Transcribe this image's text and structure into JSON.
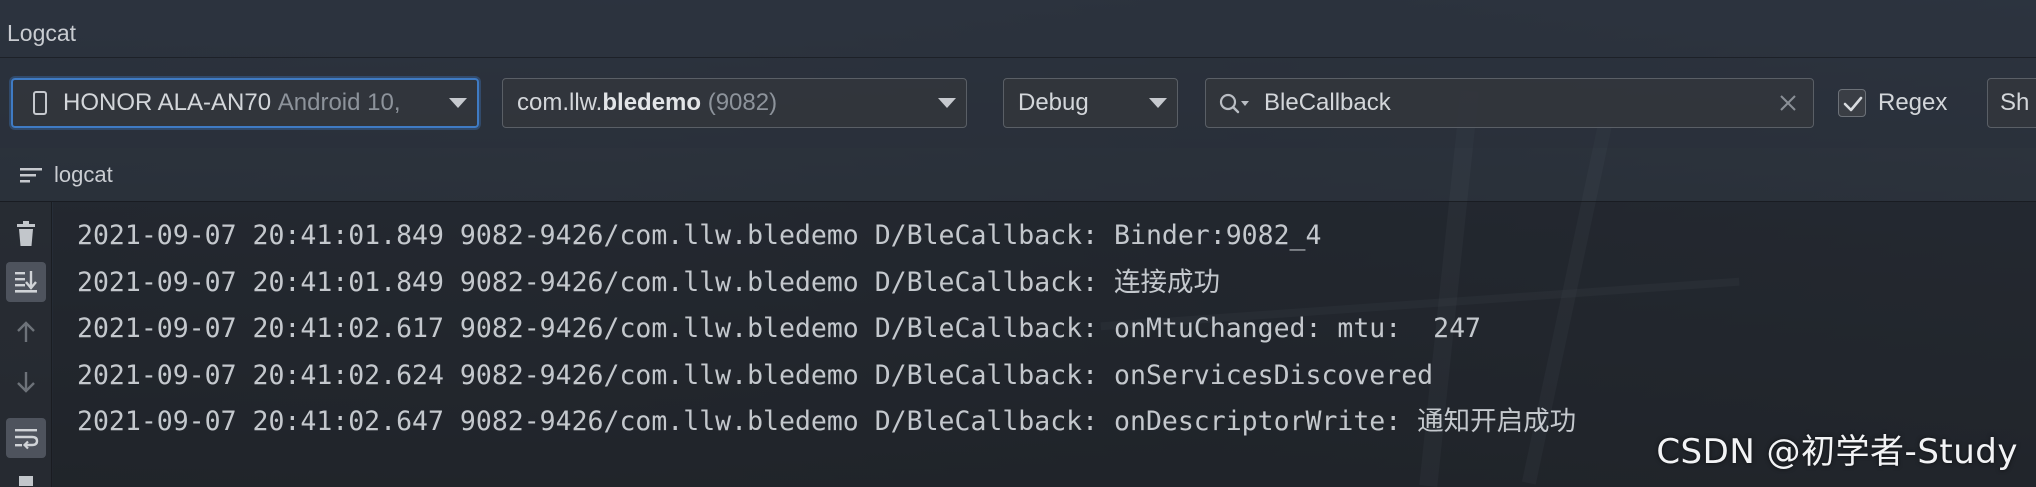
{
  "window": {
    "title": "Logcat"
  },
  "toolbar": {
    "device": {
      "name": "HONOR ALA-AN70",
      "detail": "Android 10,"
    },
    "package": {
      "prefix": "com.llw.",
      "bold": "bledemo",
      "pid": "(9082)"
    },
    "log_level": "Debug",
    "search": {
      "value": "BleCallback"
    },
    "regex": {
      "label": "Regex",
      "checked": true
    },
    "show_label": "Sh"
  },
  "tab": {
    "label": "logcat"
  },
  "log_lines": [
    "2021-09-07 20:41:01.849 9082-9426/com.llw.bledemo D/BleCallback: Binder:9082_4",
    "2021-09-07 20:41:01.849 9082-9426/com.llw.bledemo D/BleCallback: 连接成功",
    "2021-09-07 20:41:02.617 9082-9426/com.llw.bledemo D/BleCallback: onMtuChanged: mtu:  247",
    "2021-09-07 20:41:02.624 9082-9426/com.llw.bledemo D/BleCallback: onServicesDiscovered",
    "2021-09-07 20:41:02.647 9082-9426/com.llw.bledemo D/BleCallback: onDescriptorWrite: 通知开启成功"
  ],
  "watermark": "CSDN @初学者-Study",
  "icons": {
    "gutter": [
      "trash-icon",
      "scroll-to-end-icon",
      "arrow-up-icon",
      "arrow-down-icon",
      "soft-wrap-icon"
    ],
    "toolbar": [
      "phone-icon",
      "chevron-down-icon",
      "search-icon",
      "clear-icon",
      "checkmark-icon"
    ],
    "tab": "logcat-lines-icon"
  },
  "colors": {
    "focus_border": "#3f7bc4",
    "log_text": "#c4c8cd"
  }
}
